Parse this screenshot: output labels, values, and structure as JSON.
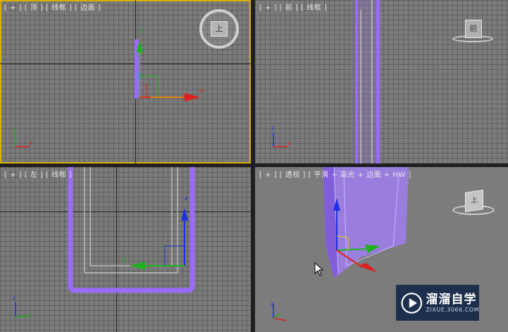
{
  "viewports": {
    "top": {
      "label": "[ + ] [ 顶 ] [ 线框 ] [ 边面 ]"
    },
    "front": {
      "label": "[ + ] [ 前 ] [ 线框 ]"
    },
    "left": {
      "label": "[ + ] [ 左 ] [ 线框 ]"
    },
    "perspective": {
      "label": "[ + ] [ 透视 ] [ 平滑 + 高光 + 边面 + HW ]"
    }
  },
  "viewcube": {
    "top_face": "上",
    "front_face": "前",
    "persp_face": "上"
  },
  "axes": {
    "x": "x",
    "y": "y",
    "z": "z"
  },
  "watermark": {
    "title": "溜溜自学",
    "url": "ZIXUE.3066.COM"
  },
  "colors": {
    "selection": "#9a6bff",
    "active_viewport_border": "#d8b100",
    "gizmo_x": "#e02020",
    "gizmo_y": "#20b020",
    "gizmo_z": "#2030e0"
  }
}
